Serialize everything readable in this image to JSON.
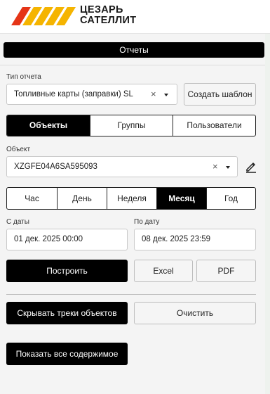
{
  "brand": {
    "line1": "ЦЕЗАРЬ",
    "line2": "САТЕЛЛИТ",
    "stripe_color": "#f5b400",
    "stripe_color_dark": "#e53517"
  },
  "report_button": "Отчеты",
  "report_type": {
    "label": "Тип отчета",
    "value": "Топливные карты (заправки) SL",
    "clear_icon": "×",
    "create_template": "Создать шаблон"
  },
  "object_tabs": [
    {
      "label": "Объекты",
      "active": true
    },
    {
      "label": "Группы",
      "active": false
    },
    {
      "label": "Пользователи",
      "active": false
    }
  ],
  "object": {
    "label": "Объект",
    "value": "XZGFE04A6SA595093",
    "clear_icon": "×"
  },
  "period_tabs": [
    {
      "label": "Час",
      "active": false
    },
    {
      "label": "День",
      "active": false
    },
    {
      "label": "Неделя",
      "active": false
    },
    {
      "label": "Месяц",
      "active": true
    },
    {
      "label": "Год",
      "active": false
    }
  ],
  "date_from": {
    "label": "С даты",
    "value": "01 дек. 2025 00:00"
  },
  "date_to": {
    "label": "По дату",
    "value": "08 дек. 2025 23:59"
  },
  "actions": {
    "build": "Построить",
    "excel": "Excel",
    "pdf": "PDF"
  },
  "tracks": {
    "hide": "Скрывать треки объектов",
    "clear": "Очистить"
  },
  "show_all": "Показать все содержимое",
  "colors": {
    "accent": "#000000",
    "border": "#c9c9c9"
  }
}
